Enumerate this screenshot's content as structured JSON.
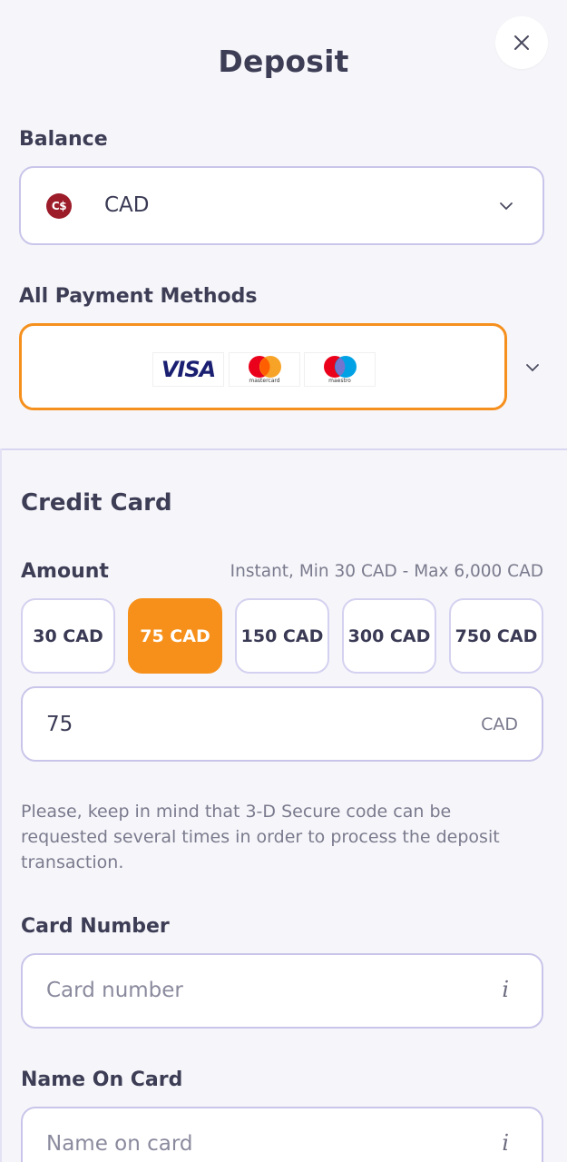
{
  "header": {
    "title": "Deposit"
  },
  "balance": {
    "label": "Balance",
    "currency_badge": "C$",
    "selected": "CAD"
  },
  "payment_methods": {
    "label": "All Payment Methods",
    "logos": [
      "VISA",
      "mastercard",
      "maestro"
    ]
  },
  "credit_card": {
    "title": "Credit Card",
    "amount_label": "Amount",
    "amount_hint": "Instant, Min 30 CAD - Max 6,000 CAD",
    "presets": [
      "30 CAD",
      "75 CAD",
      "150 CAD",
      "300 CAD",
      "750 CAD"
    ],
    "selected_preset_index": 1,
    "amount_value": "75",
    "amount_suffix": "CAD",
    "notice": "Please, keep in mind that 3-D Secure code can be requested several times in order to process the deposit transaction.",
    "card_number_label": "Card Number",
    "card_number_placeholder": "Card number",
    "name_label": "Name On Card",
    "name_placeholder": "Name on card",
    "info_glyph": "i"
  },
  "colors": {
    "accent": "#f6901a",
    "border": "#c9c5ea",
    "background": "#f6f6fa"
  }
}
